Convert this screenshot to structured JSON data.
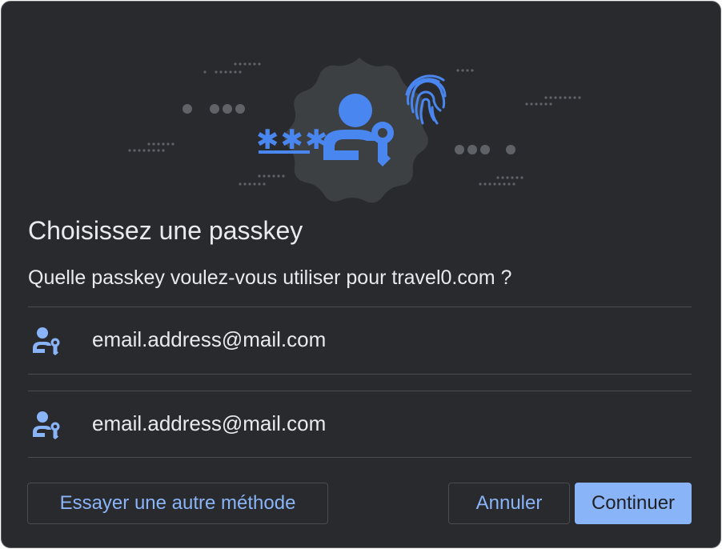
{
  "dialog": {
    "title": "Choisissez une passkey",
    "subtitle": "Quelle passkey voulez-vous utiliser pour travel0.com ?"
  },
  "accounts": [
    {
      "label": "email.address@mail.com",
      "icon": "passkey-user-icon"
    },
    {
      "label": "email.address@mail.com",
      "icon": "passkey-user-icon"
    }
  ],
  "buttons": {
    "other_method": "Essayer une autre méthode",
    "cancel": "Annuler",
    "continue": "Continuer"
  },
  "illustration": {
    "password_mask": "***",
    "icons": [
      "passkey-user-icon",
      "fingerprint-icon"
    ]
  },
  "colors": {
    "background": "#292a2d",
    "accent": "#8ab4f8",
    "illustration_blue": "#4a86f0",
    "text": "#e8eaed",
    "divider": "#4a4c50"
  }
}
